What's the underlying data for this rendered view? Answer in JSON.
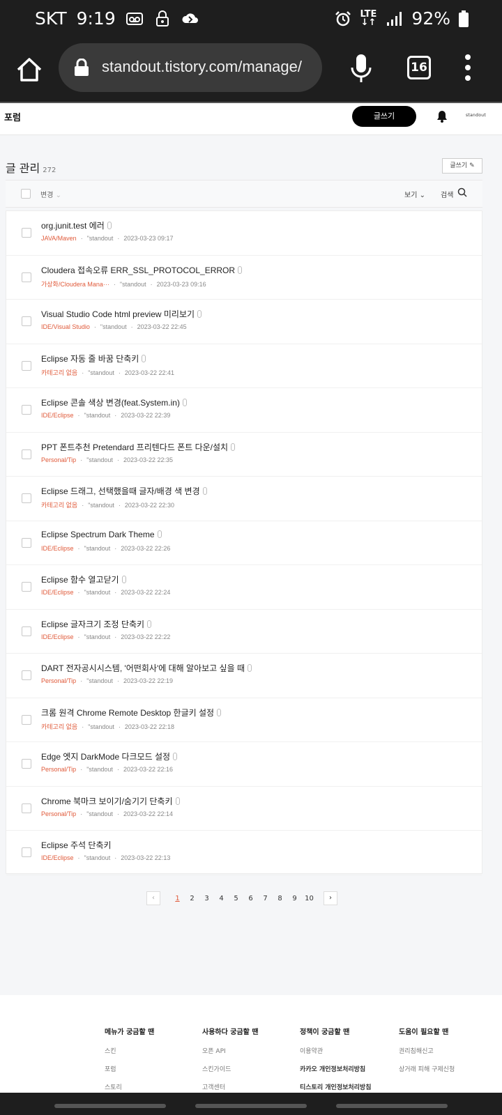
{
  "status_bar": {
    "carrier": "SKT",
    "time": "9:19",
    "network": "LTE",
    "battery": "92%"
  },
  "browser": {
    "url": "standout.tistory.com/manage/",
    "tab_count": "16"
  },
  "app_header": {
    "forum_label": "포럼",
    "write_label": "글쓰기",
    "profile_text": "standout"
  },
  "page": {
    "title": "글 관리",
    "count": "272",
    "write_small": "글쓰기",
    "change_label": "변경",
    "view_label": "보기",
    "search_label": "검색"
  },
  "posts": [
    {
      "title": "org.junit.test 에러",
      "category": "JAVA/Maven",
      "author": "standout",
      "date": "2023-03-23 09:17",
      "attach": true
    },
    {
      "title": "Cloudera 접속오류 ERR_SSL_PROTOCOL_ERROR",
      "category": "가상화/Cloudera Mana···",
      "author": "standout",
      "date": "2023-03-23 09:16",
      "attach": true
    },
    {
      "title": "Visual Studio Code html preview 미리보기",
      "category": "IDE/Visual Studio",
      "author": "standout",
      "date": "2023-03-22 22:45",
      "attach": true
    },
    {
      "title": "Eclipse 자동 줄 바꿈 단축키",
      "category": "카테고리 없음",
      "author": "standout",
      "date": "2023-03-22 22:41",
      "attach": true
    },
    {
      "title": "Eclipse 콘솔 색상 변경(feat.System.in)",
      "category": "IDE/Eclipse",
      "author": "standout",
      "date": "2023-03-22 22:39",
      "attach": true
    },
    {
      "title": "PPT 폰트추천 Pretendard 프리텐다드 폰트 다운/설치",
      "category": "Personal/Tip",
      "author": "standout",
      "date": "2023-03-22 22:35",
      "attach": true
    },
    {
      "title": "Eclipse 드래그, 선택했을때 글자/배경 색 변경",
      "category": "카테고리 없음",
      "author": "standout",
      "date": "2023-03-22 22:30",
      "attach": true
    },
    {
      "title": "Eclipse Spectrum Dark Theme",
      "category": "IDE/Eclipse",
      "author": "standout",
      "date": "2023-03-22 22:26",
      "attach": true
    },
    {
      "title": "Eclipse 함수 열고닫기",
      "category": "IDE/Eclipse",
      "author": "standout",
      "date": "2023-03-22 22:24",
      "attach": true
    },
    {
      "title": "Eclipse 글자크기 조정 단축키",
      "category": "IDE/Eclipse",
      "author": "standout",
      "date": "2023-03-22 22:22",
      "attach": true
    },
    {
      "title": "DART 전자공시시스템, '어떤회사'에 대해 알아보고 싶을 때",
      "category": "Personal/Tip",
      "author": "standout",
      "date": "2023-03-22 22:19",
      "attach": true
    },
    {
      "title": "크롬 원격 Chrome Remote Desktop 한글키 설정",
      "category": "카테고리 없음",
      "author": "standout",
      "date": "2023-03-22 22:18",
      "attach": true
    },
    {
      "title": "Edge 엣지 DarkMode 다크모드 설정",
      "category": "Personal/Tip",
      "author": "standout",
      "date": "2023-03-22 22:16",
      "attach": true
    },
    {
      "title": "Chrome 북마크 보이기/숨기기 단축키",
      "category": "Personal/Tip",
      "author": "standout",
      "date": "2023-03-22 22:14",
      "attach": true
    },
    {
      "title": "Eclipse 주석 단축키",
      "category": "IDE/Eclipse",
      "author": "standout",
      "date": "2023-03-22 22:13",
      "attach": false
    }
  ],
  "pager": {
    "pages": [
      "1",
      "2",
      "3",
      "4",
      "5",
      "6",
      "7",
      "8",
      "9",
      "10"
    ],
    "current": "1"
  },
  "footer": {
    "columns": [
      {
        "heading": "메뉴가 궁금할 땐",
        "items": [
          "스킨",
          "포럼",
          "스토리"
        ]
      },
      {
        "heading": "사용하다 궁금할 땐",
        "items": [
          "오픈 API",
          "스킨가이드",
          "고객센터"
        ]
      },
      {
        "heading": "정책이 궁금할 땐",
        "items": [
          "이용약관",
          "카카오 개인정보처리방침",
          "티스토리 개인정보처리방침"
        ]
      },
      {
        "heading": "도움이 필요할 땐",
        "items": [
          "권리침해신고",
          "상거래 피해 구제신청"
        ]
      }
    ]
  },
  "colors": {
    "category": "#e05a3a",
    "dark_bar": "#1e1e1e",
    "url_pill": "#3a3a3a"
  }
}
